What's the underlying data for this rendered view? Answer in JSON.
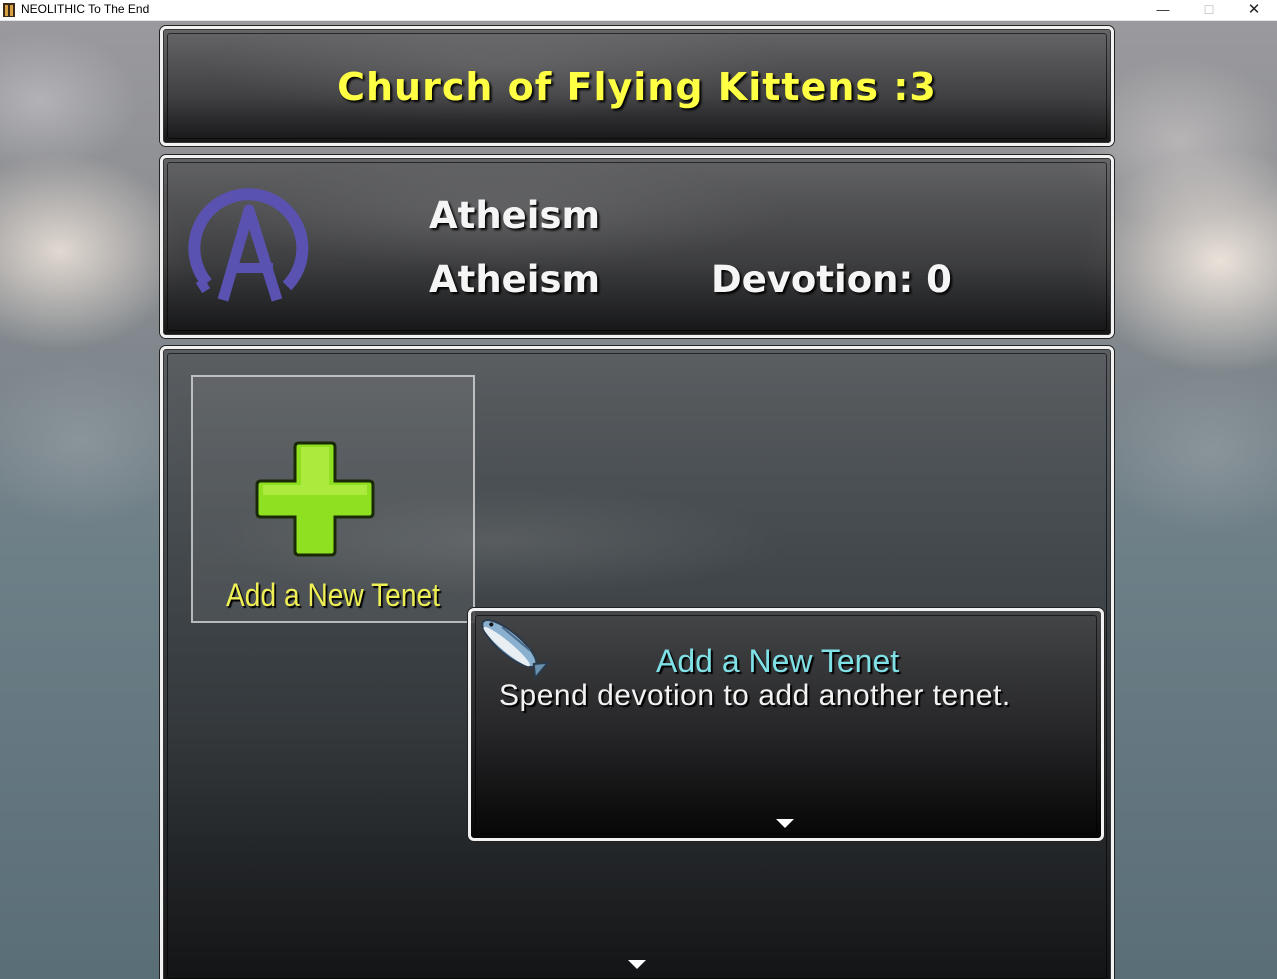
{
  "window": {
    "title": "NEOLITHIC To The End",
    "minimize_glyph": "—",
    "maximize_glyph": "☐",
    "close_glyph": "✕"
  },
  "header": {
    "church_title": "Church of Flying Kittens :3"
  },
  "info": {
    "icon": "atheism-symbol-icon",
    "icon_color": "#5a52b0",
    "religion_name": "Atheism",
    "religion_type": "Atheism",
    "devotion_label": "Devotion: 0"
  },
  "tenets": {
    "items": [
      {
        "label": "Add a New Tenet",
        "icon": "green-plus-icon"
      }
    ]
  },
  "help": {
    "title": "Add a New Tenet",
    "body": "Spend devotion to add another tenet."
  },
  "colors": {
    "title_yellow": "#ffff44",
    "label_yellow": "#eeee55",
    "help_title_cyan": "#7fe0e6",
    "plus_green": "#8fe020"
  },
  "cursor": {
    "icon": "fish-cursor-icon"
  }
}
